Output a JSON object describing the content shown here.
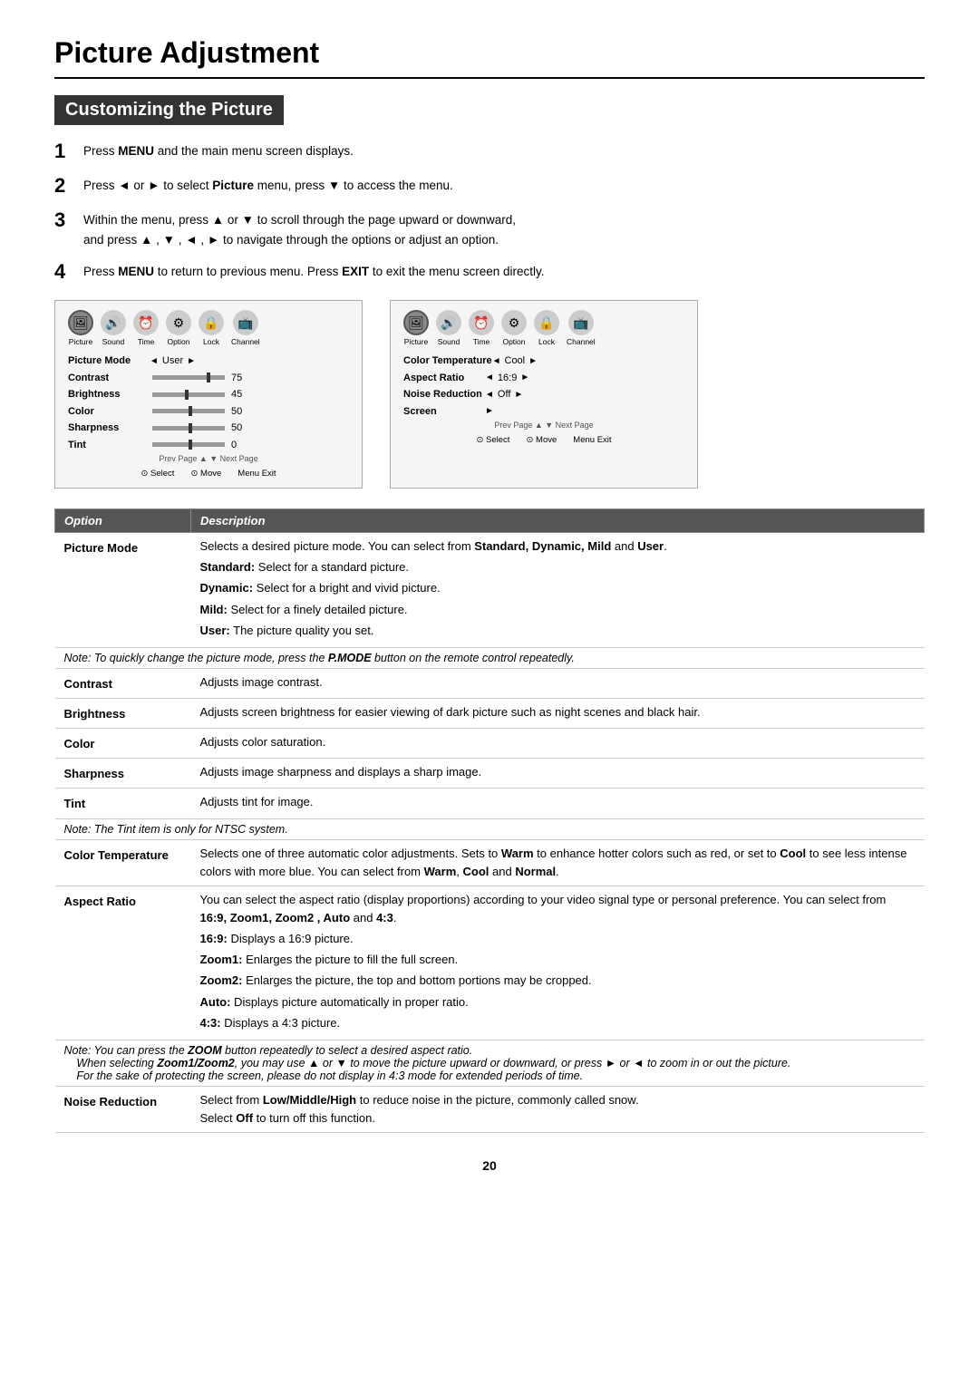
{
  "page": {
    "title": "Picture Adjustment",
    "section": "Customizing the Picture",
    "page_number": "20"
  },
  "steps": [
    {
      "num": "1",
      "text": "Press <b>MENU</b> and the main menu screen displays."
    },
    {
      "num": "2",
      "text": "Press ◄ or ► to select <b>Picture</b> menu,  press ▼  to access the menu."
    },
    {
      "num": "3",
      "text": "Within the menu, press ▲ or ▼ to scroll through the page upward or downward,\nand press ▲ , ▼ , ◄ , ► to navigate through the options or adjust an option."
    },
    {
      "num": "4",
      "text": "Press <b>MENU</b> to return to previous menu. Press <b>EXIT</b> to exit the menu screen directly."
    }
  ],
  "menu_left": {
    "icons": [
      "Picture",
      "Sound",
      "Time",
      "Option",
      "Lock",
      "Channel"
    ],
    "active_icon": "Picture",
    "rows": [
      {
        "label": "Picture Mode",
        "left_arrow": true,
        "value": "User",
        "right_arrow": true,
        "slider": false
      },
      {
        "label": "Contrast",
        "left_arrow": false,
        "value": "75",
        "right_arrow": false,
        "slider": true,
        "slider_pos": 0.75
      },
      {
        "label": "Brightness",
        "left_arrow": false,
        "value": "45",
        "right_arrow": false,
        "slider": true,
        "slider_pos": 0.45
      },
      {
        "label": "Color",
        "left_arrow": false,
        "value": "50",
        "right_arrow": false,
        "slider": true,
        "slider_pos": 0.5
      },
      {
        "label": "Sharpness",
        "left_arrow": false,
        "value": "50",
        "right_arrow": false,
        "slider": true,
        "slider_pos": 0.5
      },
      {
        "label": "Tint",
        "left_arrow": false,
        "value": "0",
        "right_arrow": false,
        "slider": true,
        "slider_pos": 0.5
      }
    ],
    "footer": {
      "select": "Select",
      "move": "Move",
      "exit": "Exit"
    }
  },
  "menu_right": {
    "icons": [
      "Picture",
      "Sound",
      "Time",
      "Option",
      "Lock",
      "Channel"
    ],
    "active_icon": "Picture",
    "rows": [
      {
        "label": "Color Temperature",
        "left_arrow": true,
        "value": "Cool",
        "right_arrow": true,
        "slider": false
      },
      {
        "label": "Aspect Ratio",
        "left_arrow": true,
        "value": "16:9",
        "right_arrow": true,
        "slider": false
      },
      {
        "label": "Noise Reduction",
        "left_arrow": true,
        "value": "Off",
        "right_arrow": true,
        "slider": false
      },
      {
        "label": "Screen",
        "left_arrow": false,
        "value": "",
        "right_arrow": true,
        "slider": false
      }
    ],
    "footer": {
      "select": "Select",
      "move": "Move",
      "exit": "Exit"
    }
  },
  "table": {
    "header": [
      "Option",
      "Description"
    ],
    "rows": [
      {
        "option": "Picture Mode",
        "descriptions": [
          "Selects a desired picture mode. You can select from <b>Standard, Dynamic, Mild</b> and <b>User</b>.",
          "<b>Standard:</b> Select for a standard picture.",
          "<b>Dynamic:</b> Select for a bright and vivid picture.",
          "<b>Mild:</b> Select for a finely detailed picture.",
          "<b>User:</b> The picture quality you set."
        ],
        "note": "<i>Note: To quickly change the picture mode, press the <b>P.MODE</b> button on the remote control repeatedly.</i>"
      },
      {
        "option": "Contrast",
        "descriptions": [
          "Adjusts image contrast."
        ],
        "note": null
      },
      {
        "option": "Brightness",
        "descriptions": [
          "Adjusts screen brightness for easier viewing of dark picture such as night scenes and black hair."
        ],
        "note": null
      },
      {
        "option": "Color",
        "descriptions": [
          "Adjusts color saturation."
        ],
        "note": null
      },
      {
        "option": "Sharpness",
        "descriptions": [
          "Adjusts image sharpness and displays a sharp image."
        ],
        "note": null
      },
      {
        "option": "Tint",
        "descriptions": [
          "Adjusts tint for image."
        ],
        "note": "<i>Note: The Tint item is only for NTSC system.</i>"
      },
      {
        "option": "Color Temperature",
        "descriptions": [
          "Selects one of three automatic color adjustments.  Sets to <b>Warm</b> to enhance hotter colors such as red,  or set to <b>Cool</b> to see less intense colors with more blue.  You can select from <b>Warm</b>, <b>Cool</b> and <b>Normal</b>."
        ],
        "note": null
      },
      {
        "option": "Aspect Ratio",
        "descriptions": [
          "You can select the aspect ratio (display proportions) according to your video signal type or personal preference. You can select from <b>16:9,  Zoom1, Zoom2 , Auto</b> and <b>4:3</b>.",
          "<b>16:9:</b> Displays a 16:9 picture.",
          "<b>Zoom1:</b> Enlarges the picture to fill the full screen.",
          "<b>Zoom2:</b> Enlarges the picture, the top and bottom portions may be cropped.",
          "<b>Auto:</b> Displays picture automatically in proper ratio.",
          "<b>4:3:</b> Displays a 4:3 picture."
        ],
        "note": "<i>Note: You can press the <b>ZOOM</b> button repeatedly to select a desired aspect ratio.<br>&nbsp;&nbsp;&nbsp;&nbsp;<i>When selecting <b>Zoom1/Zoom2</b>, you may use ▲ or ▼ to move the picture upward or downward, or press ► or ◄ to zoom in or out the picture.</i><br>&nbsp;&nbsp;&nbsp;&nbsp;<i>For the sake of protecting the screen, please do not display in 4:3 mode for extended periods of time.</i></i>"
      },
      {
        "option": "Noise Reduction",
        "descriptions": [
          "Select from <b>Low/Middle/High</b> to reduce noise in the picture, commonly called snow.<br>Select <b>Off</b> to turn off this function."
        ],
        "note": null
      }
    ]
  }
}
